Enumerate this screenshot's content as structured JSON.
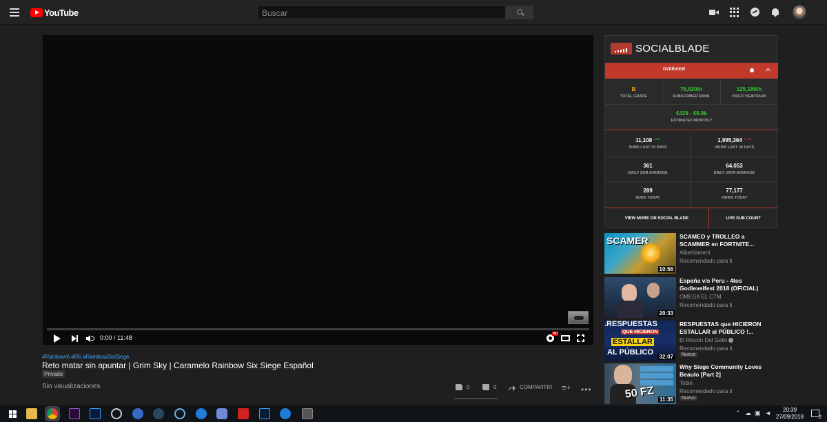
{
  "header": {
    "logo_text": "YouTube",
    "search_placeholder": "Buscar"
  },
  "player": {
    "time": "0:00 / 11:48",
    "progress_fraction": 0.0,
    "hd_badge": "HD"
  },
  "video": {
    "hashtags": "#Rainbow6 #R6 #RainbowSixSiege",
    "title": "Reto matar sin apuntar | Grim Sky | Caramelo Rainbow Six Siege Español",
    "privacy": "Privado",
    "views": "Sin visualizaciones",
    "likes": "0",
    "dislikes": "0",
    "share_label": "COMPARTIR"
  },
  "socialblade": {
    "title": "SOCIALBLADE",
    "tab": "OVERVIEW",
    "grade": {
      "value": "B",
      "label": "TOTAL GRADE"
    },
    "sub_rank": {
      "value": "76,620th",
      "label": "SUBSCRIBER RANK"
    },
    "view_rank": {
      "value": "125,186th",
      "label": "VIDEO VIEW RANK"
    },
    "monthly": {
      "value": "€428 - €6.8k",
      "label": "ESTIMATED MONTHLY"
    },
    "subs30": {
      "value": "11,108",
      "delta": "▲2%",
      "label": "SUBS LAST 30 DAYS"
    },
    "views30": {
      "value": "1,995,364",
      "delta": "▼-4%",
      "label": "VIEWS LAST 30 DAYS"
    },
    "daily_sub": {
      "value": "361",
      "label": "DAILY SUB AVERAGE"
    },
    "daily_view": {
      "value": "64,053",
      "label": "DAILY VIEW AVERAGE"
    },
    "subs_today": {
      "value": "289",
      "label": "SUBS TODAY"
    },
    "views_today": {
      "value": "77,177",
      "label": "VIEWS TODAY"
    },
    "btn_more": "VIEW MORE ON SOCIAL BLADE",
    "btn_live": "LIVE SUB COUNT",
    "colors": {
      "accent": "#c0392b",
      "green": "#31c831",
      "orange": "#f4a21c"
    }
  },
  "recommendations": [
    {
      "title": "SCAMEO y TROLLEO a SCAMMER en FORTNITE...",
      "channel": "Albertisment",
      "reason": "Recomendado para ti",
      "duration": "10:56",
      "thumb_text": "SCAMER"
    },
    {
      "title": "España v/s Peru - 4tos Godlevelfest 2018 (OFICIAL)",
      "channel": "OMEGA EL CTM",
      "reason": "Recomendado para ti",
      "duration": "20:33"
    },
    {
      "title": "RESPUESTAS que HICIERON ESTALLAR al PÚBLICO !...",
      "channel": "El Rincón Del Gallo",
      "reason": "Recomendado para ti",
      "badge": "Nuevo",
      "duration": "32:07",
      "thumb_text": ".RESPUESTAS",
      "thumb_text2": "QUE HICIERON",
      "thumb_text3": "ESTALLAR",
      "thumb_text4": "AL PÚBLICO"
    },
    {
      "title": "Why Siege Community Loves Beaulo [Part 2]",
      "channel": "Tobie",
      "reason": "Recomendado para ti",
      "badge": "Nuevo",
      "duration": "11:35",
      "thumb_text": "50 FZ"
    }
  ],
  "taskbar": {
    "time": "20:39",
    "date": "27/09/2018",
    "notifications": "2"
  }
}
